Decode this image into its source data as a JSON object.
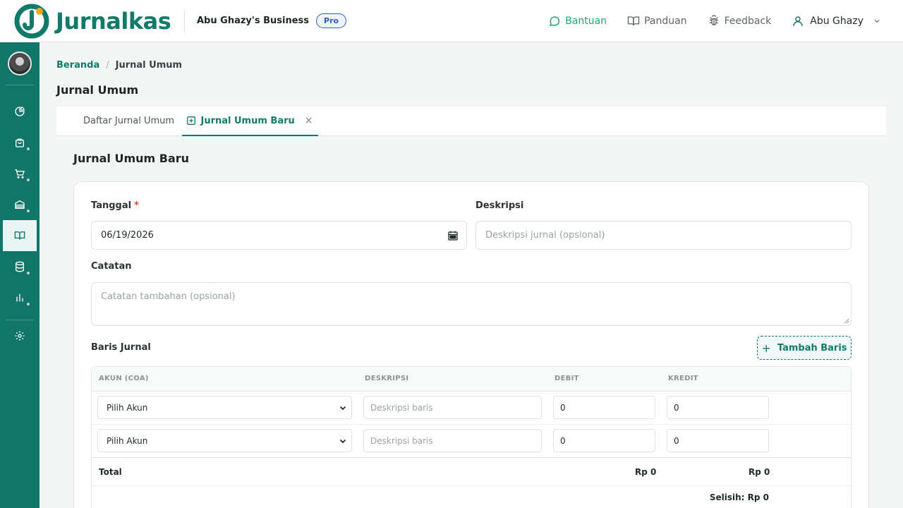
{
  "brand": {
    "name": "Jurnalkas",
    "color": "#127a6a"
  },
  "header": {
    "business_name": "Abu Ghazy's Business",
    "plan_badge": "Pro",
    "links": {
      "help": "Bantuan",
      "guide": "Panduan",
      "feedback": "Feedback"
    },
    "user_name": "Abu Ghazy"
  },
  "sidebar": {
    "items": [
      {
        "icon": "dashboard-pie-icon"
      },
      {
        "icon": "shopping-bag-icon"
      },
      {
        "icon": "cart-icon"
      },
      {
        "icon": "bank-icon"
      },
      {
        "icon": "book-icon",
        "active": true
      },
      {
        "icon": "database-icon"
      },
      {
        "icon": "bar-chart-icon"
      },
      {
        "icon": "gear-icon"
      }
    ]
  },
  "breadcrumb": {
    "home": "Beranda",
    "separator": "/",
    "current": "Jurnal Umum"
  },
  "page_title": "Jurnal Umum",
  "tabs": {
    "list_label": "Daftar Jurnal Umum",
    "new_label": "Jurnal Umum Baru",
    "close": "×"
  },
  "form": {
    "title": "Jurnal Umum Baru",
    "date_label": "Tanggal",
    "required_mark": "*",
    "date_value": "06/19/2026",
    "description_label": "Deskripsi",
    "description_placeholder": "Deskripsi jurnal (opsional)",
    "notes_label": "Catatan",
    "notes_placeholder": "Catatan tambahan (opsional)",
    "lines_label": "Baris Jurnal",
    "add_line_button": "Tambah Baris"
  },
  "table": {
    "columns": [
      "AKUN (COA)",
      "DESKRIPSI",
      "DEBIT",
      "KREDIT"
    ],
    "rows": [
      {
        "account": "Pilih Akun",
        "description_placeholder": "Deskripsi baris",
        "debit": "0",
        "credit": "0"
      },
      {
        "account": "Pilih Akun",
        "description_placeholder": "Deskripsi baris",
        "debit": "0",
        "credit": "0"
      }
    ],
    "total_label": "Total",
    "total_debit": "Rp 0",
    "total_credit": "Rp 0",
    "difference": "Selisih: Rp 0"
  }
}
